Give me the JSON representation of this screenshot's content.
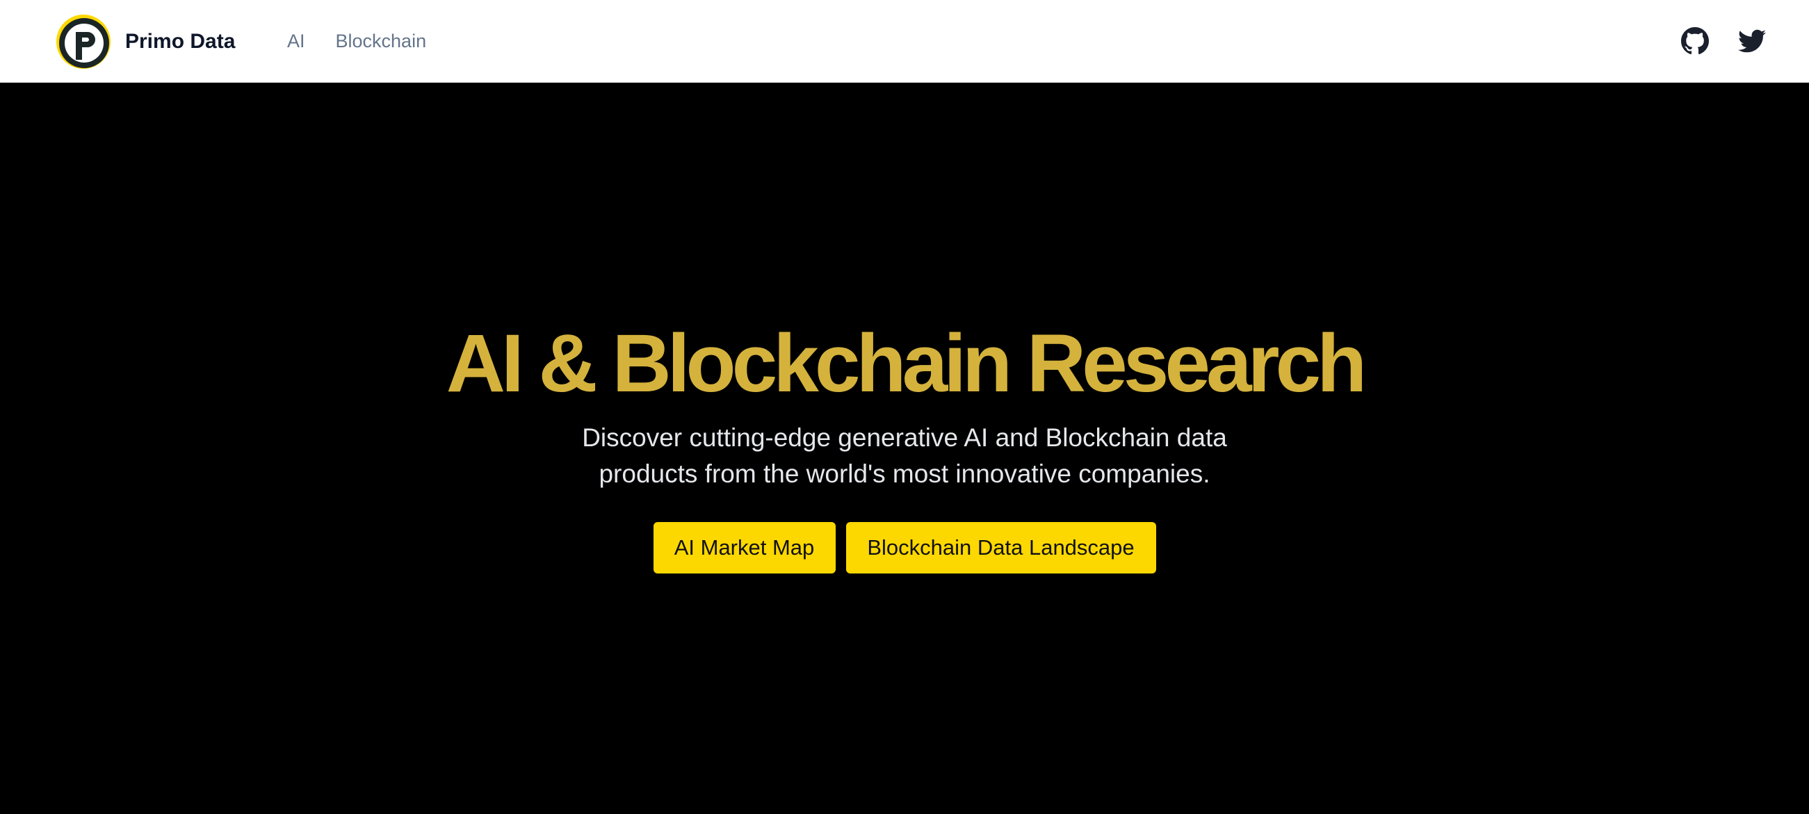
{
  "nav": {
    "brand_name": "Primo Data",
    "links": [
      "AI",
      "Blockchain"
    ],
    "icons": [
      "github-icon",
      "twitter-icon"
    ]
  },
  "hero": {
    "title": "AI & Blockchain Research",
    "subtitle": "Discover cutting-edge generative AI and Blockchain data products from the world's most innovative companies.",
    "buttons": [
      "AI Market Map",
      "Blockchain Data Landscape"
    ]
  },
  "colors": {
    "nav_background": "#ffffff",
    "hero_background": "#000000",
    "title_gold": "#d4b23c",
    "button_yellow": "#fdd800",
    "logo_dark": "#1b2526",
    "logo_ring": "#fdd800",
    "nav_link": "#64748b"
  }
}
